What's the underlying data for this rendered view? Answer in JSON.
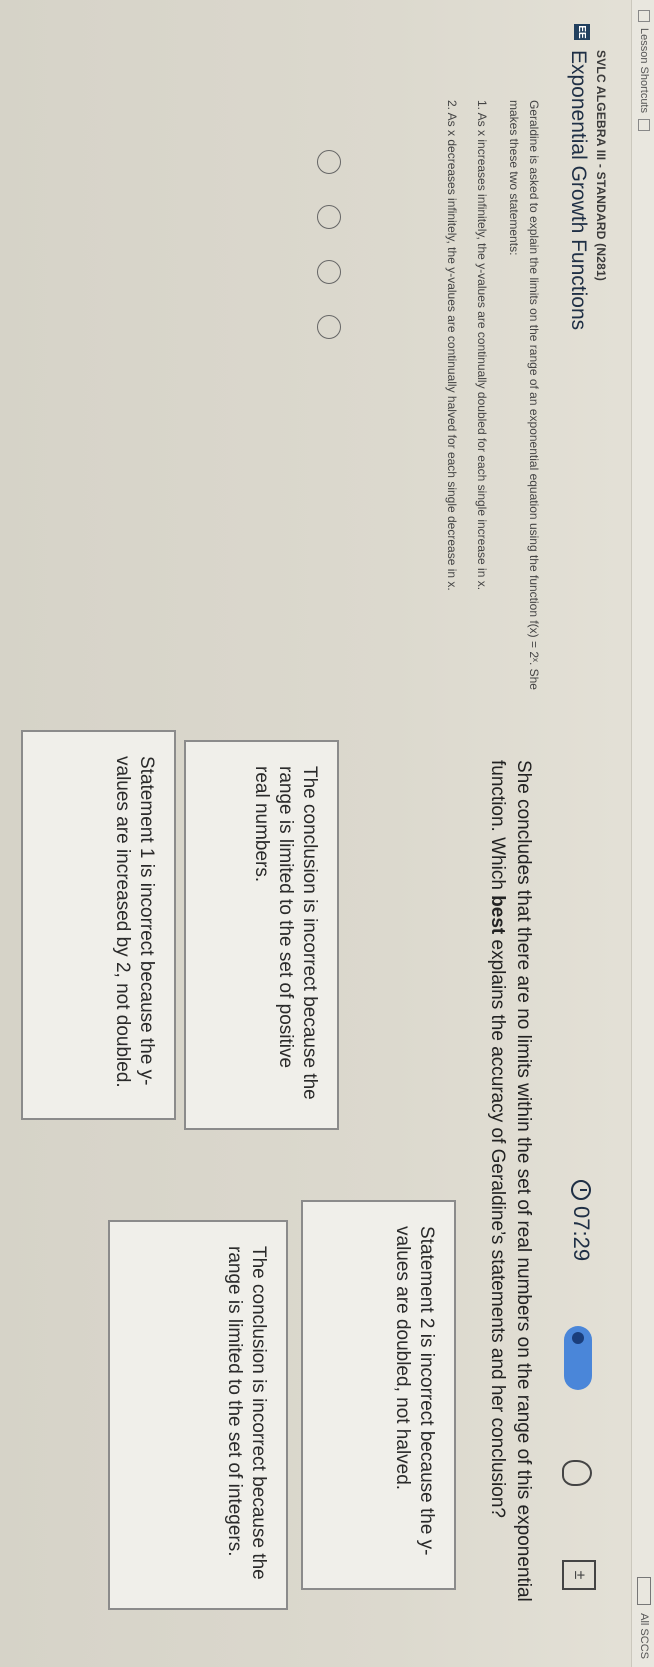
{
  "topbar": {
    "label": "Lesson Shortcuts",
    "right_text": "All SCCS"
  },
  "header": {
    "course_code": "EE",
    "course": "SVLC ALGEBRA III - STANDARD (N281)",
    "lesson": "Exponential Growth Functions",
    "timer": "07:29",
    "calc_symbol": "±"
  },
  "problem": {
    "intro": "Geraldine is asked to explain the limits on the range of an exponential equation using the function f(x) = 2ˣ. She makes these two statements:",
    "statement1": "1. As x increases infinitely, the y-values are continually doubled for each single increase in x.",
    "statement2": "2. As x decreases infinitely, the y-values are continually halved for each single decrease in x.",
    "question_pre": "She concludes that there are no limits within the set of real numbers on the range of this exponential function. Which ",
    "question_bold": "best",
    "question_post": " explains the accuracy of Geraldine’s statements and her conclusion?"
  },
  "choices": [
    {
      "text": "The conclusion is incorrect because the range is limited to the set of positive real numbers."
    },
    {
      "text": "Statement 2 is incorrect because the y-values are doubled, not halved."
    },
    {
      "text": "Statement 1 is incorrect because the y-values are increased by 2, not doubled."
    },
    {
      "text": "The conclusion is incorrect because the range is limited to the set of integers."
    }
  ],
  "colors": {
    "accent": "#4a86d9",
    "title": "#1f2f45"
  }
}
